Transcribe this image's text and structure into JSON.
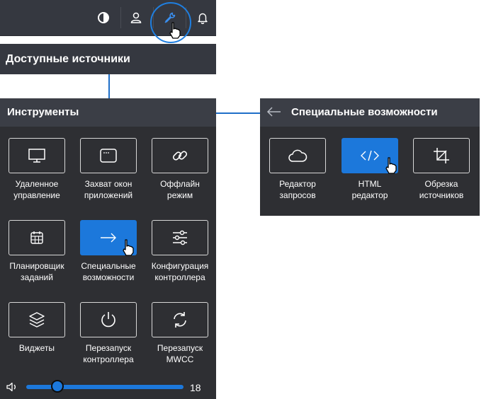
{
  "toolbar": {
    "icons": [
      "contrast-icon",
      "user-icon",
      "wrench-icon",
      "bell-icon"
    ]
  },
  "sources_panel": {
    "title": "Доступные источники"
  },
  "tools_panel": {
    "title": "Инструменты",
    "tiles": [
      {
        "icon": "monitor-icon",
        "line1": "Удаленное",
        "line2": "управление",
        "active": false
      },
      {
        "icon": "window-icon",
        "line1": "Захват окон",
        "line2": "приложений",
        "active": false
      },
      {
        "icon": "link-icon",
        "line1": "Оффлайн",
        "line2": "режим",
        "active": false
      },
      {
        "icon": "calendar-icon",
        "line1": "Планировщик",
        "line2": "заданий",
        "active": false
      },
      {
        "icon": "arrow-right-icon",
        "line1": "Специальные",
        "line2": "возможности",
        "active": true
      },
      {
        "icon": "sliders-icon",
        "line1": "Конфигурация",
        "line2": "контроллера",
        "active": false
      },
      {
        "icon": "layers-icon",
        "line1": "Виджеты",
        "line2": "",
        "active": false
      },
      {
        "icon": "power-icon",
        "line1": "Перезапуск",
        "line2": "контроллера",
        "active": false
      },
      {
        "icon": "refresh-icon",
        "line1": "Перезапуск",
        "line2": "MWCC",
        "active": false
      }
    ],
    "volume": {
      "icon": "speaker-icon",
      "value": "18",
      "level": 0.2
    }
  },
  "access_panel": {
    "title": "Специальные возможности",
    "tiles": [
      {
        "icon": "cloud-icon",
        "line1": "Редактор",
        "line2": "запросов",
        "active": false
      },
      {
        "icon": "code-icon",
        "line1": "HTML",
        "line2": "редактор",
        "active": true
      },
      {
        "icon": "crop-icon",
        "line1": "Обрезка",
        "line2": "источников",
        "active": false
      }
    ]
  },
  "colors": {
    "accent": "#1c78db",
    "panel": "#2e2f33",
    "header": "#3b3e46"
  }
}
